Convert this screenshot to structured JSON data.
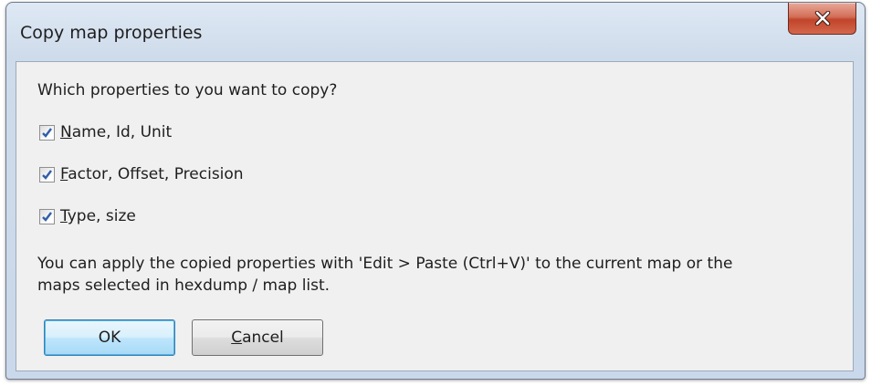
{
  "window": {
    "title": "Copy map properties",
    "close_icon": "close-x-icon"
  },
  "dialog": {
    "prompt": "Which properties to you want to copy?",
    "options": [
      {
        "accel": "N",
        "rest": "ame, Id, Unit",
        "checked": true
      },
      {
        "accel": "F",
        "rest": "actor, Offset, Precision",
        "checked": true
      },
      {
        "accel": "T",
        "rest": "ype, size",
        "checked": true
      }
    ],
    "info_line1": "You can apply the copied properties with 'Edit > Paste (Ctrl+V)' to the current map or the",
    "info_line2": "maps selected in hexdump / map list.",
    "ok_label": "OK",
    "cancel_accel": "C",
    "cancel_rest": "ancel"
  },
  "colors": {
    "close_button": "#c7492f",
    "checkmark": "#2f5fa8",
    "default_button_border": "#3c7fb1"
  }
}
